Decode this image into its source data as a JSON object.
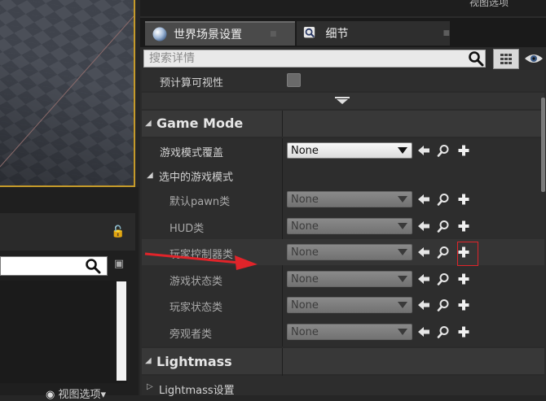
{
  "left_panel": {
    "view_options_label": "视图选项"
  },
  "top_strip_text": "视图选项",
  "tabs": [
    {
      "label": "世界场景设置",
      "icon": "globe-icon",
      "active": true
    },
    {
      "label": "细节",
      "icon": "magnifier-icon",
      "active": false
    }
  ],
  "search": {
    "placeholder": "搜索详情",
    "value": ""
  },
  "properties": {
    "precomputed_visibility_label": "预计算可视性",
    "game_mode": {
      "title": "Game Mode",
      "override_label": "游戏模式覆盖",
      "override_value": "None",
      "selected_group_label": "选中的游戏模式",
      "rows": [
        {
          "label": "默认pawn类",
          "value": "None"
        },
        {
          "label": "HUD类",
          "value": "None"
        },
        {
          "label": "玩家控制器类",
          "value": "None"
        },
        {
          "label": "游戏状态类",
          "value": "None"
        },
        {
          "label": "玩家状态类",
          "value": "None"
        },
        {
          "label": "旁观者类",
          "value": "None"
        }
      ]
    },
    "lightmass": {
      "title": "Lightmass",
      "settings_label": "Lightmass设置"
    }
  },
  "colors": {
    "annotation_arrow": "#e0242a",
    "viewport_border": "#c59a2a",
    "panel_bg": "#2b2b2b"
  }
}
